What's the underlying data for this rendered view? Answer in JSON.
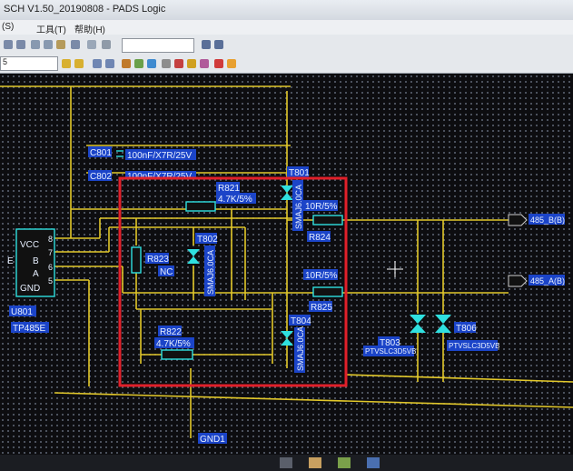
{
  "window": {
    "title": "SCH V1.50_20190808 - PADS Logic"
  },
  "menu": {
    "items": [
      "(S)",
      "工具(T)",
      "帮助(H)"
    ]
  },
  "toolbar": {
    "zoom_value": "5"
  },
  "schematic": {
    "components": {
      "c801_ref": "C801",
      "c801_value": "100nF/X7R/25V",
      "c802_ref": "C802",
      "c802_value": "100nF/X7R/25V",
      "r821_ref": "R821",
      "r821_value": "4.7K/5%",
      "r822_ref": "R822",
      "r822_value": "4.7K/5%",
      "r823_ref": "R823",
      "r823_value": "NC",
      "r824_ref": "R824",
      "r824_value": "10R/5%",
      "r825_ref": "R825",
      "r825_value": "10R/5%",
      "t801_ref": "T801",
      "t801_value": "SMAJ6.0CA",
      "t802_ref": "T802",
      "t802_value": "SMAJ6.0CA",
      "t804_ref": "T804",
      "t804_value": "SMAJ6.0CA",
      "t803_ref": "T803",
      "t803_value": "PTVSLC3D5VB",
      "t806_ref": "T806",
      "t806_value": "PTVSLC3D5VB",
      "u801_ref": "U801",
      "u801_value": "TP485E"
    },
    "ic_pins": {
      "vcc": "VCC",
      "e": "E",
      "b": "B",
      "a": "A",
      "gnd": "GND",
      "n8": "8",
      "n7": "7",
      "n6": "6",
      "n5": "5"
    },
    "nets": {
      "port_b": "485_B(B)",
      "port_a": "485_A(B)",
      "gnd": "GND1"
    },
    "colors": {
      "wire": "#e2c82a",
      "label_bg": "#1b44c8",
      "label_text": "#e8f0ff",
      "part": "#2fe0e0",
      "highlight": "#e0202a"
    }
  }
}
